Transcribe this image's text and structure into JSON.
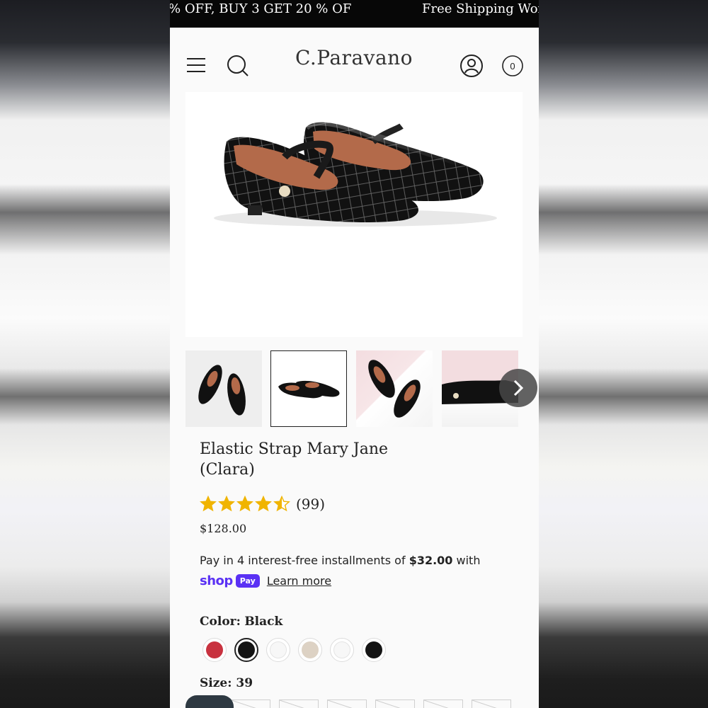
{
  "announcement": {
    "message_1": "% OFF, BUY 3 GET 20 % OF",
    "message_2": "Free Shipping Wor"
  },
  "header": {
    "logo_text": "C.Paravano",
    "cart_count": "0",
    "icons": [
      "menu-icon",
      "search-icon",
      "account-icon",
      "cart-icon"
    ]
  },
  "gallery": {
    "thumbnails": [
      {
        "name": "thumbnail-1",
        "selected": false
      },
      {
        "name": "thumbnail-2",
        "selected": true
      },
      {
        "name": "thumbnail-3",
        "selected": false
      },
      {
        "name": "thumbnail-4",
        "selected": false
      }
    ],
    "next_icon": "chevron-right-icon"
  },
  "product": {
    "title_line1": "Elastic Strap Mary Jane",
    "title_line2": "(Clara)",
    "rating": 4.5,
    "review_count": "(99)",
    "price": "$128.00"
  },
  "installments": {
    "text_before": "Pay in 4 interest-free installments of ",
    "amount": "$32.00",
    "text_after": " with",
    "shop_word": "shop",
    "pay_word": "Pay",
    "learn_more": "Learn more"
  },
  "color": {
    "label": "Color:",
    "selected": "Black",
    "swatches": [
      {
        "name": "red",
        "hex": "#c8323f"
      },
      {
        "name": "black",
        "hex": "#141414",
        "selected": true
      },
      {
        "name": "white",
        "hex": "#f7f7f7"
      },
      {
        "name": "beige",
        "hex": "#ddd2c4"
      },
      {
        "name": "white-2",
        "hex": "#f7f7f7"
      },
      {
        "name": "black-2",
        "hex": "#141414"
      }
    ]
  },
  "size": {
    "label": "Size: 39"
  },
  "colors": {
    "star": "#f0b400",
    "shop_pay": "#5a31f4",
    "announcement_bg": "#070707"
  }
}
